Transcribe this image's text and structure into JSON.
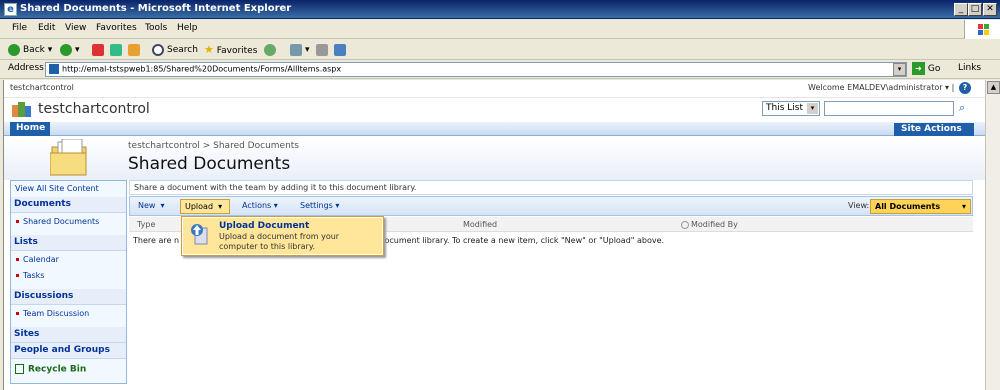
{
  "window": {
    "title": "Shared Documents - Microsoft Internet Explorer"
  },
  "menu": [
    "File",
    "Edit",
    "View",
    "Favorites",
    "Tools",
    "Help"
  ],
  "toolbar": {
    "back": "Back",
    "search": "Search",
    "favorites": "Favorites"
  },
  "address": {
    "label": "Address",
    "url": "http://emal-tstspweb1:85/Shared%20Documents/Forms/AllItems.aspx",
    "go": "Go",
    "links": "Links"
  },
  "global": {
    "site_link": "testchartcontrol",
    "welcome": "Welcome EMALDEV\\administrator"
  },
  "site": {
    "title": "testchartcontrol",
    "scope": "This List",
    "search_placeholder": ""
  },
  "nav": {
    "home": "Home",
    "site_actions": "Site Actions"
  },
  "breadcrumb": "testchartcontrol > Shared Documents",
  "page_title": "Shared Documents",
  "leftnav": {
    "view_all": "View All Site Content",
    "documents_head": "Documents",
    "documents": [
      "Shared Documents"
    ],
    "lists_head": "Lists",
    "lists": [
      "Calendar",
      "Tasks"
    ],
    "discussions_head": "Discussions",
    "discussions": [
      "Team Discussion"
    ],
    "sites_head": "Sites",
    "people_head": "People and Groups",
    "recycle": "Recycle Bin"
  },
  "description": "Share a document with the team by adding it to this document library.",
  "lv_toolbar": {
    "new": "New",
    "upload": "Upload",
    "actions": "Actions",
    "settings": "Settings",
    "view_label": "View:",
    "view_value": "All Documents"
  },
  "columns": {
    "type": "Type",
    "modified": "Modified",
    "modified_by": "Modified By"
  },
  "empty": {
    "left": "There are n",
    "right": "s\" document library. To create a new item, click \"New\" or \"Upload\" above."
  },
  "upload_menu": {
    "title": "Upload Document",
    "desc1": "Upload a document from your",
    "desc2": "computer to this library."
  }
}
